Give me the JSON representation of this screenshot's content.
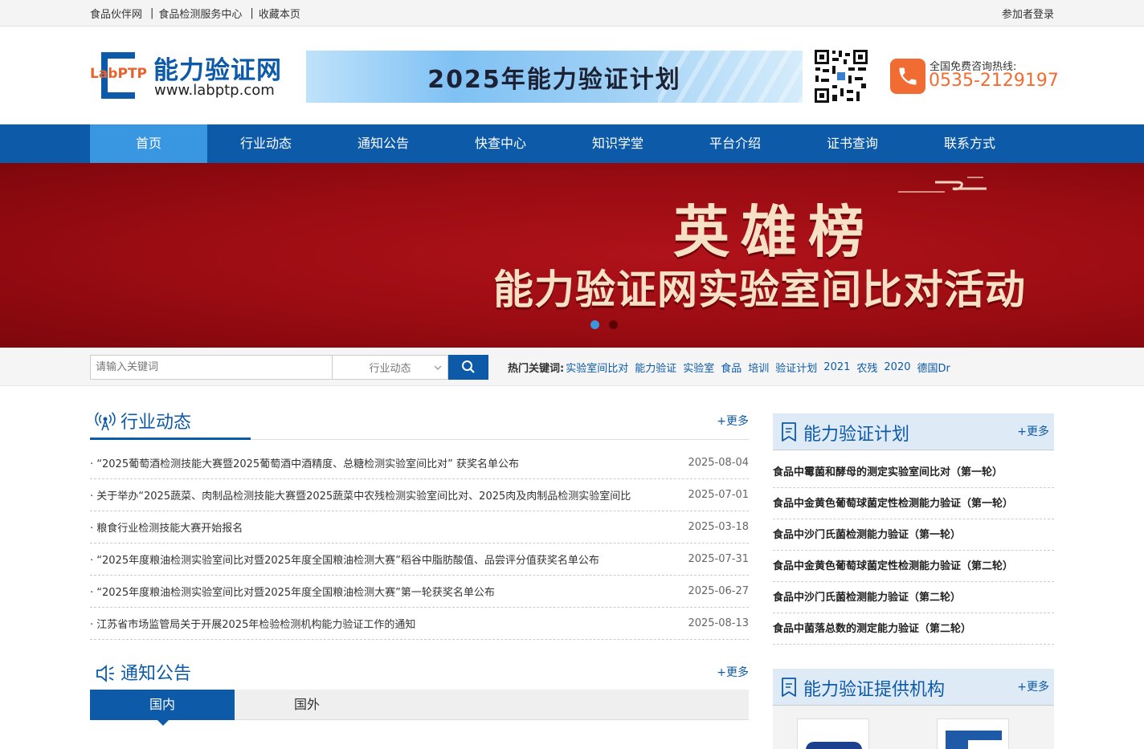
{
  "topbar": {
    "links": [
      "食品伙伴网",
      "食品检测服务中心",
      "收藏本页"
    ],
    "login": "参加者登录"
  },
  "header": {
    "logo_en_a": "Lab",
    "logo_en_b": "PTP",
    "logo_cn": "能力验证网",
    "logo_url": "www.labptp.com",
    "banner_text": "2025年能力验证计划",
    "hotline_label": "全国免费咨询热线:",
    "hotline_number": "0535-2129197"
  },
  "nav": [
    "首页",
    "行业动态",
    "通知公告",
    "快查中心",
    "知识学堂",
    "平台介绍",
    "证书查询",
    "联系方式"
  ],
  "hero": {
    "title": "英雄榜",
    "subtitle": "能力验证网实验室间比对活动"
  },
  "search": {
    "placeholder": "请输入关键词",
    "category": "行业动态",
    "hot_label": "热门关键词:",
    "keywords": [
      "实验室间比对",
      "能力验证",
      "实验室",
      "食品",
      "培训",
      "验证计划",
      "2021",
      "农残",
      "2020",
      "德国Dr"
    ]
  },
  "industry": {
    "title": "行业动态",
    "more": "+更多",
    "items": [
      {
        "title": "· “2025葡萄酒检测技能大赛暨2025葡萄酒中酒精度、总糖检测实验室间比对” 获奖名单公布",
        "date": "2025-08-04"
      },
      {
        "title": "· 关于举办“2025蔬菜、肉制品检测技能大赛暨2025蔬菜中农残检测实验室间比对、2025肉及肉制品检测实验室间比",
        "date": "2025-07-01"
      },
      {
        "title": "· 粮食行业检测技能大赛开始报名",
        "date": "2025-03-18"
      },
      {
        "title": "· “2025年度粮油检测实验室间比对暨2025年度全国粮油检测大赛”稻谷中脂肪酸值、品尝评分值获奖名单公布",
        "date": "2025-07-31"
      },
      {
        "title": "· “2025年度粮油检测实验室间比对暨2025年度全国粮油检测大赛”第一轮获奖名单公布",
        "date": "2025-06-27"
      },
      {
        "title": "· 江苏省市场监管局关于开展2025年检验检测机构能力验证工作的通知",
        "date": "2025-08-13"
      }
    ]
  },
  "notice": {
    "title": "通知公告",
    "more": "+更多",
    "tabs": [
      "国内",
      "国外"
    ]
  },
  "plan": {
    "title": "能力验证计划",
    "more": "+更多",
    "items": [
      "食品中霉菌和酵母的测定实验室间比对（第一轮）",
      "食品中金黄色葡萄球菌定性检测能力验证（第一轮）",
      "食品中沙门氏菌检测能力验证（第一轮）",
      "食品中金黄色葡萄球菌定性检测能力验证（第二轮）",
      "食品中沙门氏菌检测能力验证（第二轮）",
      "食品中菌落总数的测定能力验证（第二轮）"
    ]
  },
  "providers": {
    "title": "能力验证提供机构",
    "more": "+更多"
  },
  "colors": {
    "brand_blue": "#0c5aa8",
    "accent_orange": "#f06c33",
    "hero_red": "#9a0c12"
  }
}
